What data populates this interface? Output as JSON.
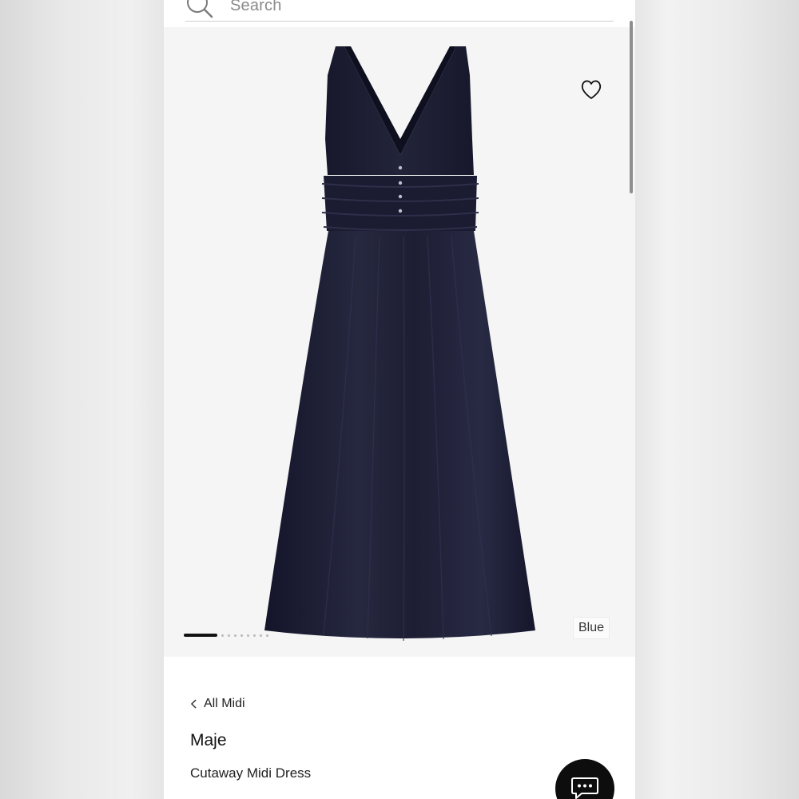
{
  "search": {
    "placeholder": "Search",
    "icon": "search-icon"
  },
  "product": {
    "image_alt": "Cutaway Midi Dress",
    "color_label": "Blue",
    "carousel": {
      "current": 1,
      "total": 9
    },
    "wishlist_icon": "heart-icon",
    "breadcrumb_label": "All Midi",
    "brand": "Maje",
    "name": "Cutaway Midi Dress"
  },
  "chat": {
    "icon": "chat-icon"
  },
  "colors": {
    "dress": "#1c1d33",
    "background": "#f5f5f5",
    "chat_button": "#0d0d0d"
  }
}
